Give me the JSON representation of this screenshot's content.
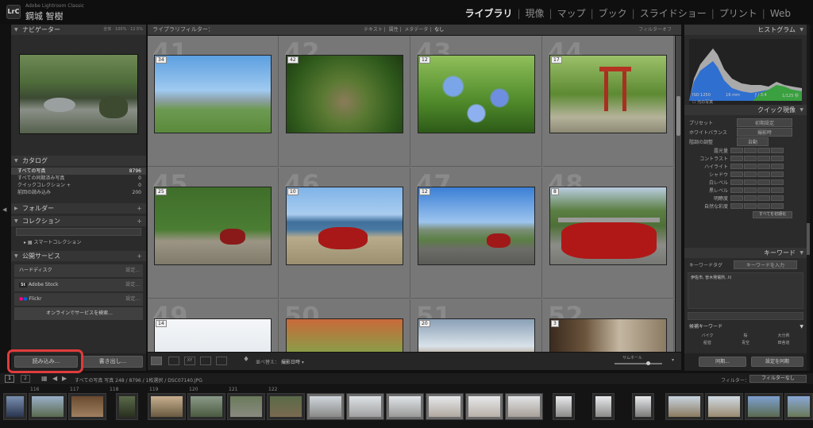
{
  "app": {
    "logo_text": "LrC",
    "subtitle": "Adobe Lightroom Classic",
    "user": "鋼城 智樹"
  },
  "modules": [
    "ライブラリ",
    "現像",
    "マップ",
    "ブック",
    "スライドショー",
    "プリント",
    "Web"
  ],
  "active_module": "ライブラリ",
  "navigator": {
    "title": "ナビゲーター",
    "zoom_options": [
      "全体",
      "100%",
      "12.5%"
    ]
  },
  "catalog": {
    "title": "カタログ",
    "items": [
      {
        "label": "すべての写真",
        "count": "8796"
      },
      {
        "label": "すべての同期済み写真",
        "count": "0"
      },
      {
        "label": "クイックコレクション +",
        "count": "0"
      },
      {
        "label": "前回の読み込み",
        "count": "200"
      }
    ]
  },
  "folders": {
    "title": "フォルダー"
  },
  "collections": {
    "title": "コレクション",
    "smart": "スマートコレクション"
  },
  "publish": {
    "title": "公開サービス",
    "services": [
      {
        "name": "ハードディスク",
        "action": "設定..."
      },
      {
        "name": "Adobe Stock",
        "action": "設定..."
      },
      {
        "name": "Flickr",
        "action": "設定..."
      }
    ],
    "find_more": "オンラインでサービスを検索..."
  },
  "buttons": {
    "import": "読み込み...",
    "export": "書き出し..."
  },
  "filter_bar": {
    "title": "ライブラリフィルター：",
    "options": [
      "テキスト",
      "属性",
      "メタデータ",
      "なし"
    ],
    "right": "フィルターオフ"
  },
  "grid": {
    "cells": [
      {
        "index": "41",
        "badge": "34"
      },
      {
        "index": "42",
        "badge": "42"
      },
      {
        "index": "43",
        "badge": "12"
      },
      {
        "index": "44",
        "badge": "17"
      },
      {
        "index": "45",
        "badge": "25"
      },
      {
        "index": "46",
        "badge": "10"
      },
      {
        "index": "47",
        "badge": "12"
      },
      {
        "index": "48",
        "badge": "8"
      },
      {
        "index": "49",
        "badge": "14"
      },
      {
        "index": "50",
        "badge": ""
      },
      {
        "index": "51",
        "badge": "20"
      },
      {
        "index": "52",
        "badge": "3"
      }
    ]
  },
  "toolbar": {
    "sort_label": "並べ替え：",
    "sort_value": "撮影日時",
    "thumb_label": "サムネール"
  },
  "histogram": {
    "title": "ヒストグラム",
    "info": [
      "ISO 1250",
      "16 mm",
      "ƒ / 3.4",
      "1/125 秒"
    ],
    "original": "元の写真"
  },
  "quick_develop": {
    "title": "クイック現像",
    "preset_label": "プリセット",
    "preset_value": "初期設定",
    "wb_label": "ホワイトバランス",
    "wb_value": "撮影時",
    "tone_label": "階調の調整",
    "auto": "自動",
    "controls": [
      "露光量",
      "コントラスト",
      "ハイライト",
      "シャドウ",
      "白レベル",
      "黒レベル",
      "明瞭度",
      "自然な彩度"
    ],
    "reset": "すべてを初期化"
  },
  "keywords": {
    "title": "キーワード",
    "tag_label": "キーワードタグ",
    "tag_value": "キーワードを入力",
    "entered": "伊佐市, 曽木発電所, 川",
    "suggest_title": "候補キーワード",
    "suggestions": [
      "バイク",
      "桜",
      "大分県",
      "船音",
      "青空",
      "田舎道"
    ]
  },
  "right_buttons": {
    "sync": "同期...",
    "sync_settings": "設定を同期"
  },
  "filmstrip": {
    "pages": [
      "1",
      "2"
    ],
    "path": "すべての写真  写真 248 / 8796 / 1枚選択 / DSC07140.JPG",
    "filter_label": "フィルター：",
    "filter_value": "フィルターなし",
    "numbers": [
      "116",
      "117",
      "118",
      "119",
      "120",
      "121",
      "122"
    ]
  }
}
